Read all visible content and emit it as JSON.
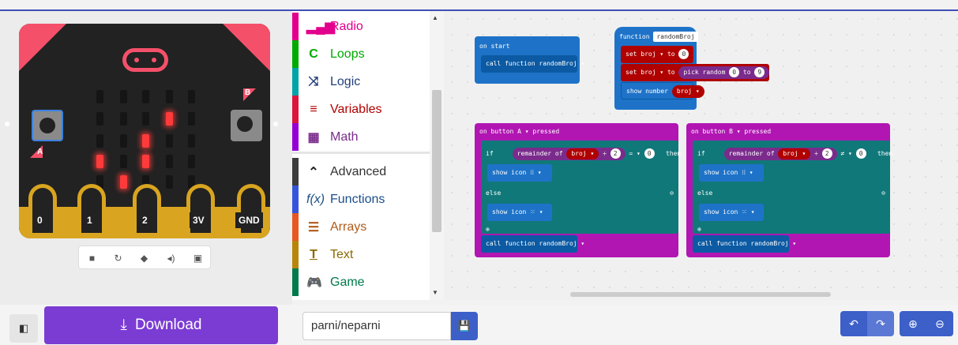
{
  "simulator": {
    "button_a": "A",
    "button_b": "B",
    "pins": [
      "0",
      "1",
      "2",
      "3V",
      "GND"
    ],
    "controls": [
      "stop-icon",
      "restart-icon",
      "slow-mo-icon",
      "mute-icon",
      "fullscreen-icon"
    ],
    "led_color": "#ff3a3a"
  },
  "toolbox": {
    "categories": [
      {
        "label": "Radio",
        "color": "#e3008c",
        "icon": "radio-icon"
      },
      {
        "label": "Loops",
        "color": "#00aa00",
        "icon": "loops-icon"
      },
      {
        "label": "Logic",
        "color": "#00a4a6",
        "icon": "logic-icon"
      },
      {
        "label": "Variables",
        "color": "#dc143c",
        "icon": "variables-icon"
      },
      {
        "label": "Math",
        "color": "#9400d3",
        "icon": "math-icon"
      },
      {
        "label": "Advanced",
        "color": "#3c3c3c",
        "icon": "chevron-up-icon"
      },
      {
        "label": "Functions",
        "color": "#3455db",
        "icon": "functions-icon"
      },
      {
        "label": "Arrays",
        "color": "#e65722",
        "icon": "arrays-icon"
      },
      {
        "label": "Text",
        "color": "#b8860b",
        "icon": "text-icon"
      },
      {
        "label": "Game",
        "color": "#007a4b",
        "icon": "game-icon"
      }
    ]
  },
  "workspace": {
    "on_start": {
      "title": "on start",
      "call": "call function  randomBroj ▾"
    },
    "func": {
      "keyword": "function",
      "name": "randomBroj",
      "set1": "set  broj ▾  to",
      "val1": "0",
      "set2": "set  broj ▾  to",
      "pick": "pick random",
      "from": "0",
      "to_kw": "to",
      "to": "9",
      "show": "show number",
      "var": "broj ▾"
    },
    "button_a": {
      "title": "on button  A ▾  pressed",
      "if": "if",
      "rem": "remainder of",
      "var": "broj ▾",
      "div": "÷",
      "two": "2",
      "eq": "= ▾",
      "zero": "0",
      "then": "then",
      "show_icon": "show icon",
      "else": "else",
      "call": "call function  randomBroj ▾"
    },
    "button_b": {
      "title": "on button  B ▾  pressed",
      "if": "if",
      "rem": "remainder of",
      "var": "broj ▾",
      "div": "÷",
      "two": "2",
      "eq": "≠ ▾",
      "zero": "0",
      "then": "then",
      "show_icon": "show icon",
      "else": "else",
      "call": "call function  randomBroj ▾"
    }
  },
  "bottom": {
    "download": "Download",
    "project_name": "parni/neparni"
  }
}
